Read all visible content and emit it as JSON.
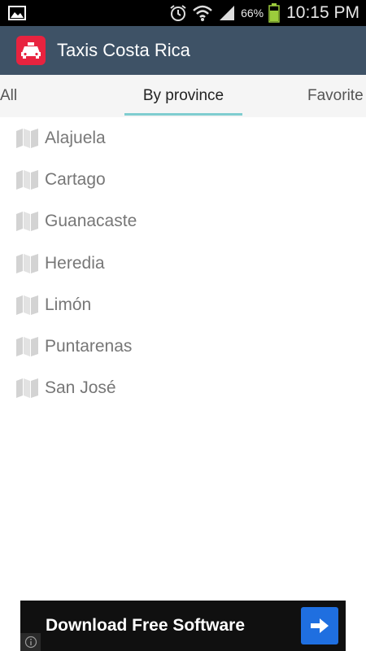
{
  "status_bar": {
    "battery_percent": "66%",
    "time": "10:15 PM",
    "icons": [
      "gallery-icon",
      "alarm-icon",
      "wifi-icon",
      "signal-icon",
      "battery-icon"
    ]
  },
  "app_bar": {
    "title": "Taxis Costa Rica",
    "icon": "taxi-icon",
    "icon_color": "#e8233f",
    "background": "#3e5266"
  },
  "tabs": {
    "items": [
      {
        "label": "All",
        "selected": false
      },
      {
        "label": "By province",
        "selected": true
      },
      {
        "label": "Favorite",
        "selected": false
      }
    ],
    "indicator_color": "#7fcdd0"
  },
  "provinces": [
    {
      "label": "Alajuela",
      "icon": "map-icon"
    },
    {
      "label": "Cartago",
      "icon": "map-icon"
    },
    {
      "label": "Guanacaste",
      "icon": "map-icon"
    },
    {
      "label": "Heredia",
      "icon": "map-icon"
    },
    {
      "label": "Limón",
      "icon": "map-icon"
    },
    {
      "label": "Puntarenas",
      "icon": "map-icon"
    },
    {
      "label": "San José",
      "icon": "map-icon"
    }
  ],
  "ad": {
    "text": "Download Free Software",
    "button_icon": "arrow-right-icon",
    "button_color": "#1f6fe0",
    "info_icon": "info-icon"
  }
}
